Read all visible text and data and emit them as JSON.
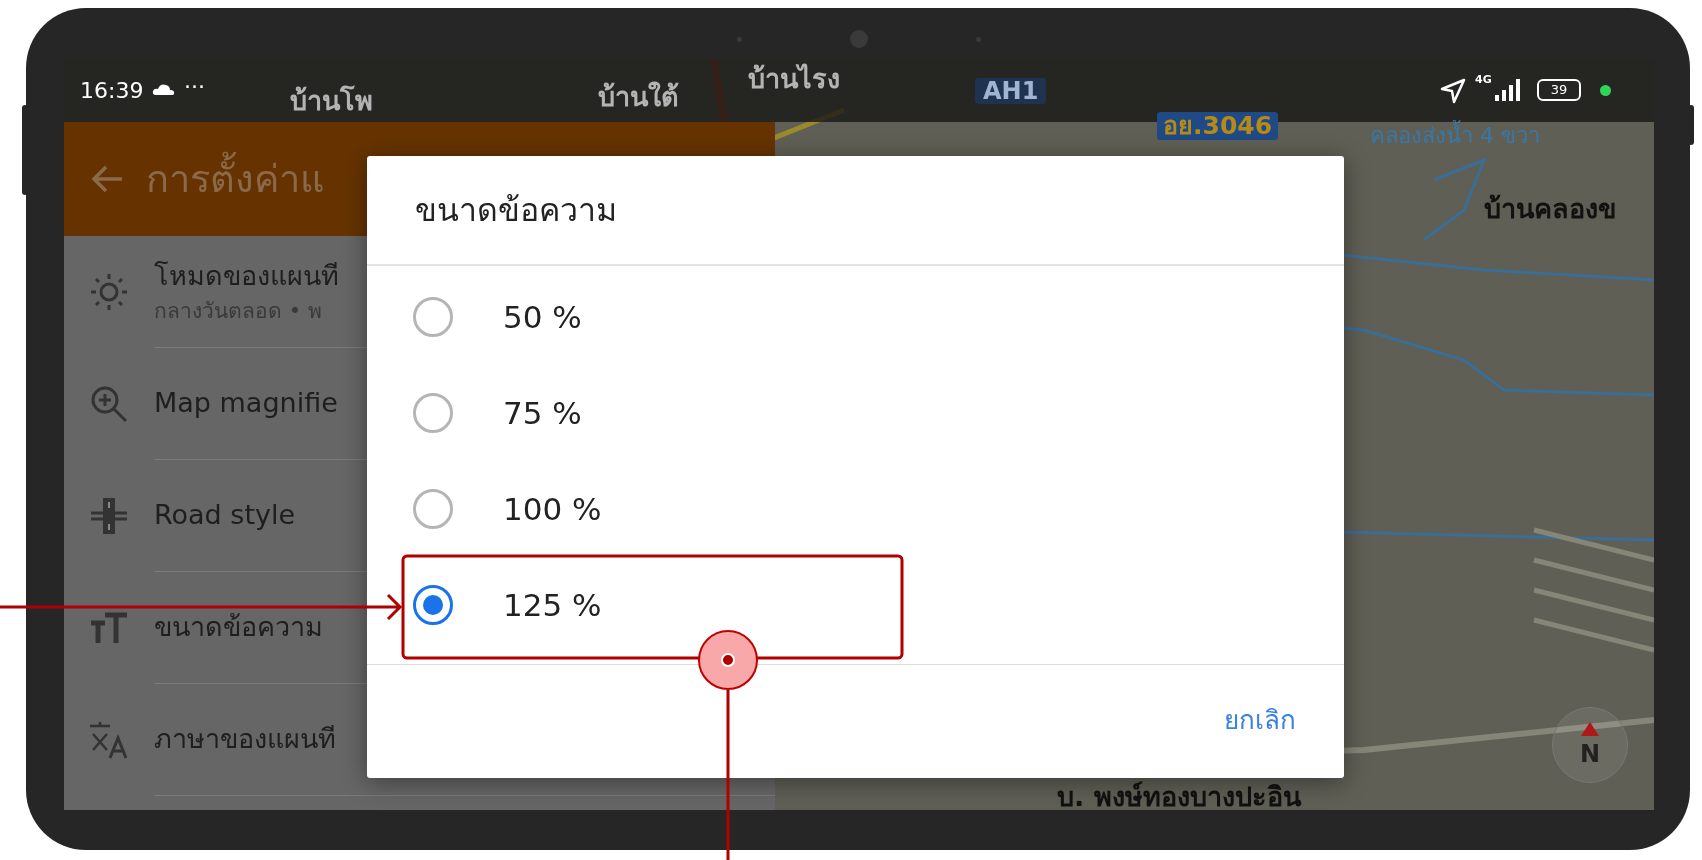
{
  "status_bar": {
    "time": "16:39",
    "more": "···",
    "network": "4G",
    "battery": "39"
  },
  "map": {
    "labels": [
      {
        "text": "บ้านโพ",
        "kind": "faded"
      },
      {
        "text": "บ้านใต้",
        "kind": "faded"
      },
      {
        "text": "บ้านไรง",
        "kind": "faded"
      },
      {
        "text": "AH1",
        "kind": "highway"
      },
      {
        "text": "อย.3046",
        "kind": "route"
      },
      {
        "text": "คลองส่งน้ำ 4 ขวา",
        "kind": "canal"
      },
      {
        "text": "บ้านคลองข",
        "kind": "place"
      },
      {
        "text": "บ. พงษ์ทองบางปะอิน",
        "kind": "place"
      }
    ],
    "compass": "N"
  },
  "settings": {
    "title": "การตั้งค่าแ",
    "items": [
      {
        "title": "โหมดของแผนที",
        "subtitle": "กลางวันตลอด • พ"
      },
      {
        "title": "Map magnifie"
      },
      {
        "title": "Road style"
      },
      {
        "title": "ขนาดข้อความ"
      },
      {
        "title": "ภาษาของแผนที"
      }
    ]
  },
  "dialog": {
    "title": "ขนาดข้อความ",
    "options": [
      {
        "label": "50 %",
        "selected": false
      },
      {
        "label": "75 %",
        "selected": false
      },
      {
        "label": "100 %",
        "selected": false
      },
      {
        "label": "125 %",
        "selected": true
      }
    ],
    "buttons": [
      "ยกเลิก"
    ]
  }
}
